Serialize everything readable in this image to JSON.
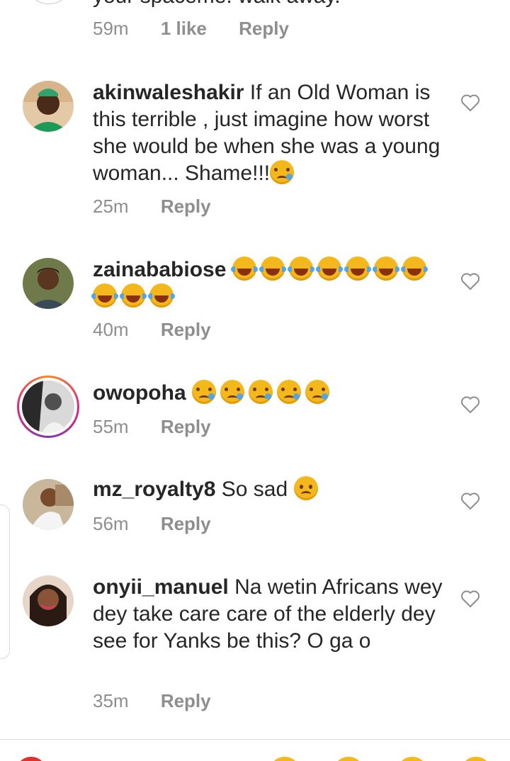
{
  "top_comment": {
    "text_fragment": "your spaceme. walk away.",
    "time": "59m",
    "likes": "1 like",
    "reply_label": "Reply"
  },
  "comments": [
    {
      "username": "akinwaleshakir",
      "text": "If an Old Woman is this terrible , just imagine how worst she would be when she was a young woman... Shame!!!",
      "emoji": [
        "crying-face"
      ],
      "time": "25m",
      "reply_label": "Reply"
    },
    {
      "username": "zainababiose",
      "text": "",
      "emoji": [
        "tears-of-joy",
        "tears-of-joy",
        "tears-of-joy",
        "tears-of-joy",
        "tears-of-joy",
        "tears-of-joy",
        "tears-of-joy",
        "tears-of-joy",
        "tears-of-joy",
        "tears-of-joy"
      ],
      "time": "40m",
      "reply_label": "Reply"
    },
    {
      "username": "owopoha",
      "text": "",
      "emoji": [
        "crying-face",
        "crying-face",
        "crying-face",
        "crying-face",
        "crying-face"
      ],
      "time": "55m",
      "reply_label": "Reply"
    },
    {
      "username": "mz_royalty8",
      "text": "So sad",
      "emoji": [
        "frowning-face"
      ],
      "time": "56m",
      "reply_label": "Reply"
    },
    {
      "username": "onyii_manuel",
      "text": "Na wetin Africans wey dey take care care of the elderly dey see for Yanks be this? O ga o",
      "emoji": [],
      "time": "35m",
      "reply_label": "Reply"
    }
  ],
  "icons": {
    "like": "heart-outline-icon"
  },
  "colors": {
    "text_primary": "#262626",
    "text_secondary": "#8e8e8e",
    "story_ring_start": "#f58529",
    "story_ring_end": "#8134af",
    "heart_outline": "#8e8e8e"
  }
}
